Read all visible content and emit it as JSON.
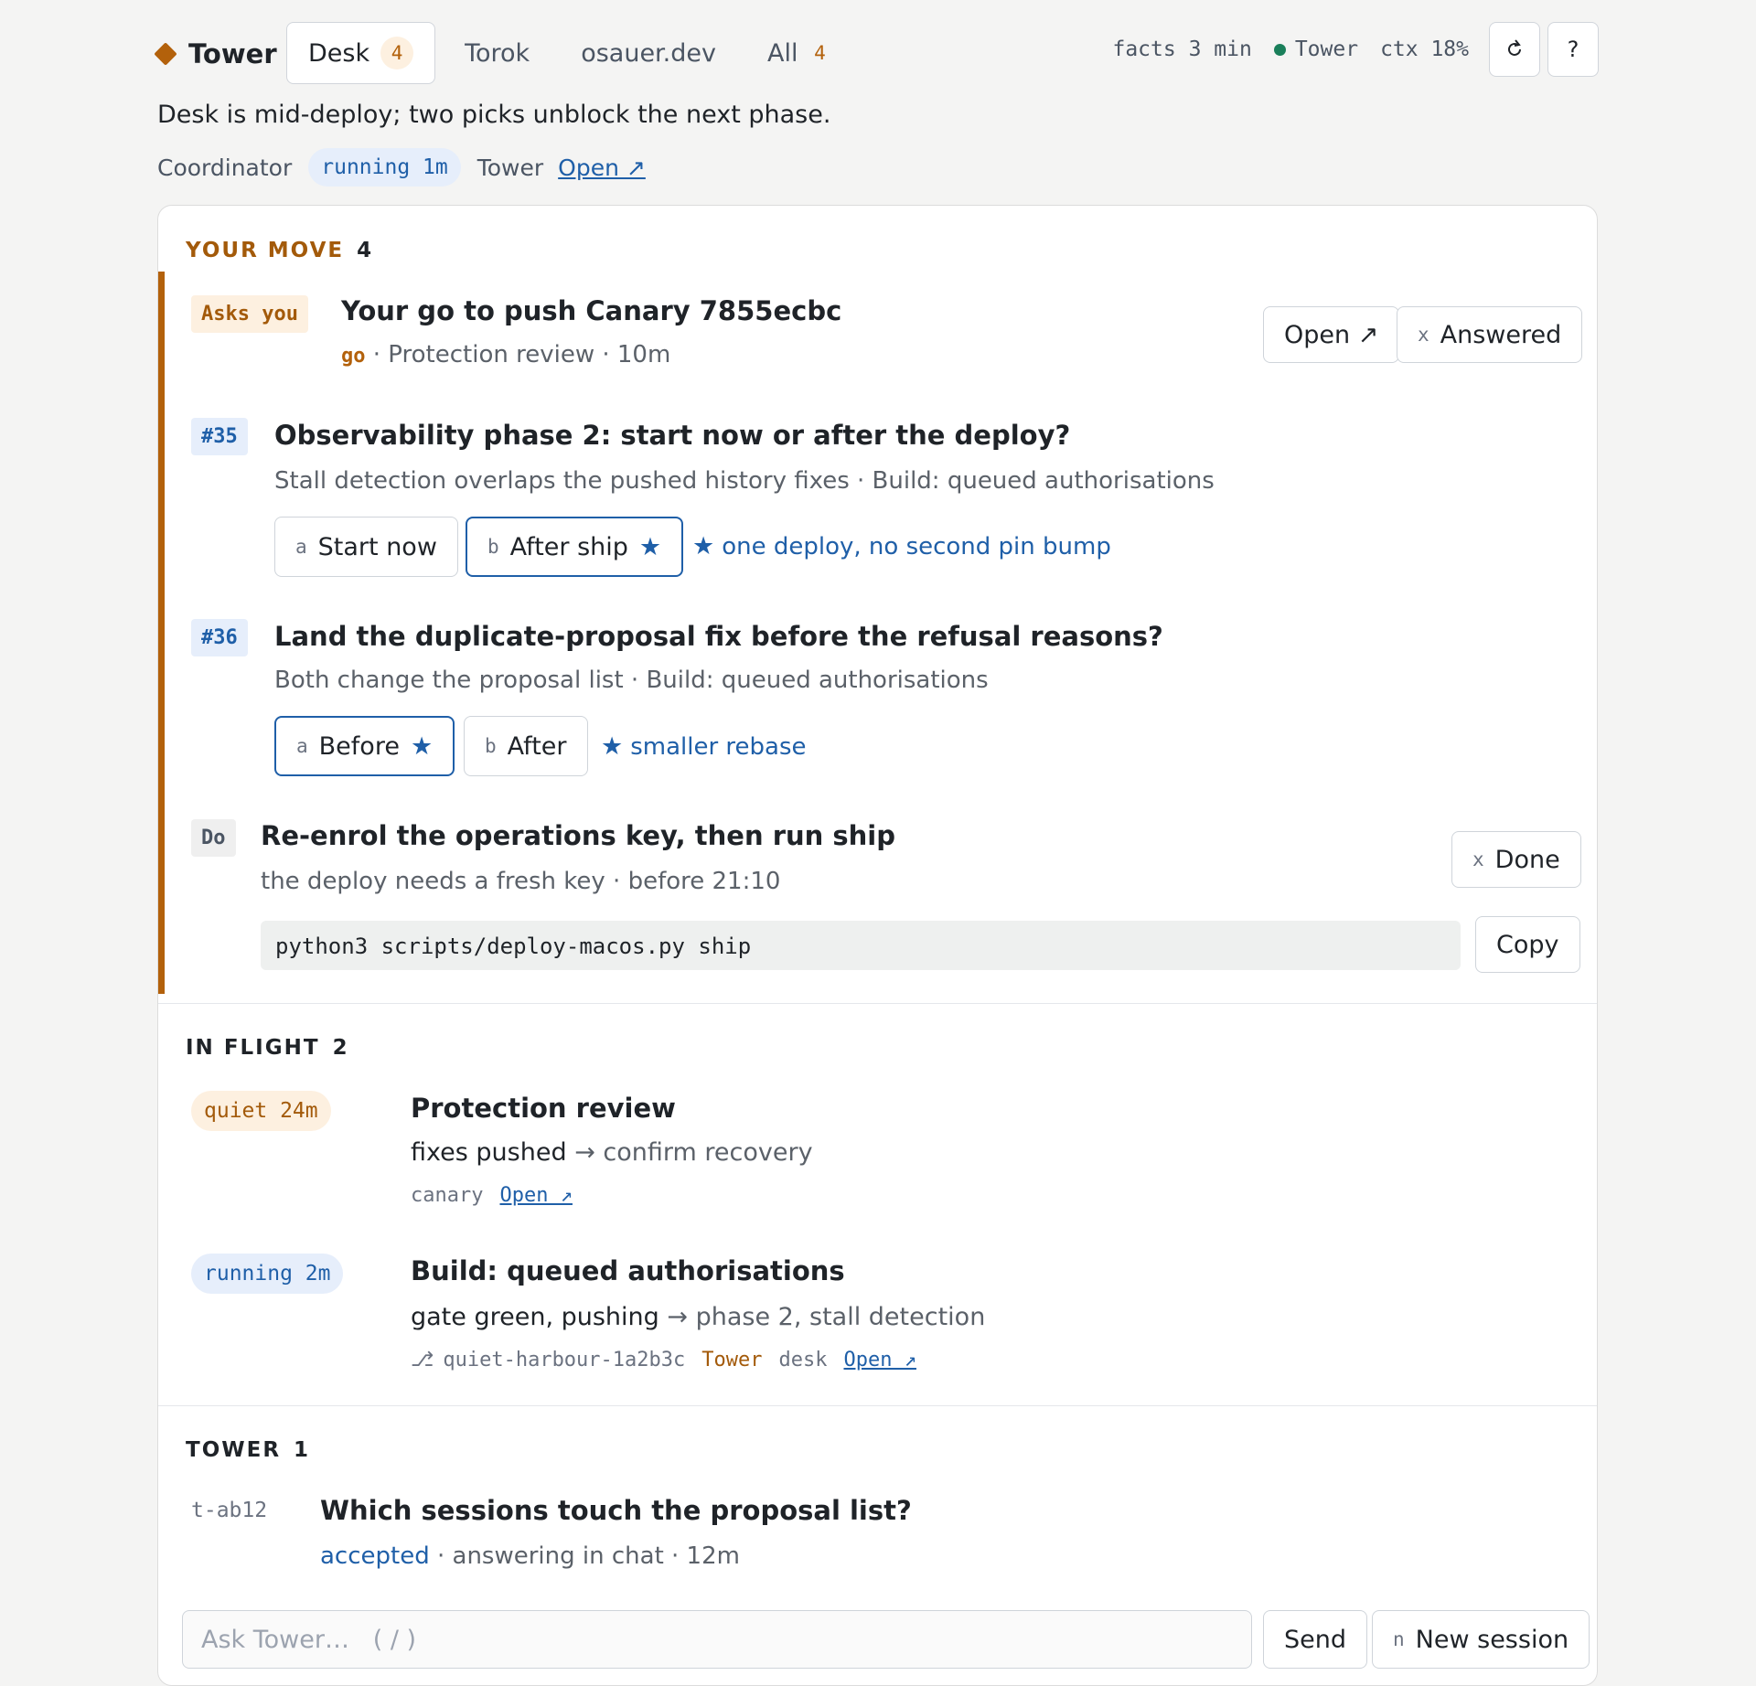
{
  "brand": {
    "name": "Tower"
  },
  "tabs": [
    {
      "label": "Desk",
      "count": "4"
    },
    {
      "label": "Torok",
      "count": ""
    },
    {
      "label": "osauer.dev",
      "count": ""
    },
    {
      "label": "All",
      "count": "4"
    }
  ],
  "status": {
    "facts": "facts 3 min",
    "agent": "Tower",
    "ctx": "ctx 18%",
    "refresh_icon": "refresh-icon",
    "help_label": "?"
  },
  "summary": "Desk is mid-deploy; two picks unblock the next phase.",
  "coordinator": {
    "label": "Coordinator",
    "state": "running 1m",
    "tower_label": "Tower",
    "open_label": "Open ↗"
  },
  "your_move": {
    "title": "YOUR MOVE",
    "count": "4",
    "ask": {
      "badge": "Asks you",
      "title": "Your go to push Canary 7855ecbc",
      "go": "go",
      "sub": " · Protection review · 10m",
      "open_label": "Open ↗",
      "answered_key": "x",
      "answered_label": "Answered"
    },
    "q35": {
      "badge": "#35",
      "title": "Observability phase 2: start now or after the deploy?",
      "sub": "Stall detection overlaps the pushed history fixes · Build: queued authorisations",
      "opt_a_key": "a",
      "opt_a": "Start now",
      "opt_b_key": "b",
      "opt_b": "After ship",
      "hint": "one deploy, no second pin bump"
    },
    "q36": {
      "badge": "#36",
      "title": "Land the duplicate-proposal fix before the refusal reasons?",
      "sub": "Both change the proposal list · Build: queued authorisations",
      "opt_a_key": "a",
      "opt_a": "Before",
      "opt_b_key": "b",
      "opt_b": "After",
      "hint": "smaller rebase"
    },
    "todo": {
      "badge": "Do",
      "title": "Re-enrol the operations key, then run ship",
      "sub": "the deploy needs a fresh key · before 21:10",
      "done_key": "x",
      "done_label": "Done",
      "command": "python3 scripts/deploy-macos.py ship",
      "copy_label": "Copy"
    }
  },
  "in_flight": {
    "title": "IN FLIGHT",
    "count": "2",
    "items": [
      {
        "state": "quiet 24m",
        "title": "Protection review",
        "from": "fixes pushed",
        "to": "confirm recovery",
        "meta": "canary",
        "open_label": "Open ↗"
      },
      {
        "state": "running 2m",
        "title": "Build: queued authorisations",
        "from": "gate green, pushing",
        "to": "phase 2, stall detection",
        "meta": "quiet-harbour-1a2b3c",
        "owner": "Tower",
        "scope": "desk",
        "open_label": "Open ↗"
      }
    ]
  },
  "tower": {
    "title": "TOWER",
    "count": "1",
    "thread": {
      "id": "t-ab12",
      "title": "Which sessions touch the proposal list?",
      "state": "accepted",
      "sub": " · answering in chat · 12m"
    }
  },
  "composer": {
    "placeholder": "Ask Tower…   ( / )",
    "send_label": "Send",
    "new_key": "n",
    "new_label": "New session"
  },
  "colors": {
    "accent": "#b3610b",
    "link": "#1f5fa8",
    "ok": "#1a7f5a"
  }
}
